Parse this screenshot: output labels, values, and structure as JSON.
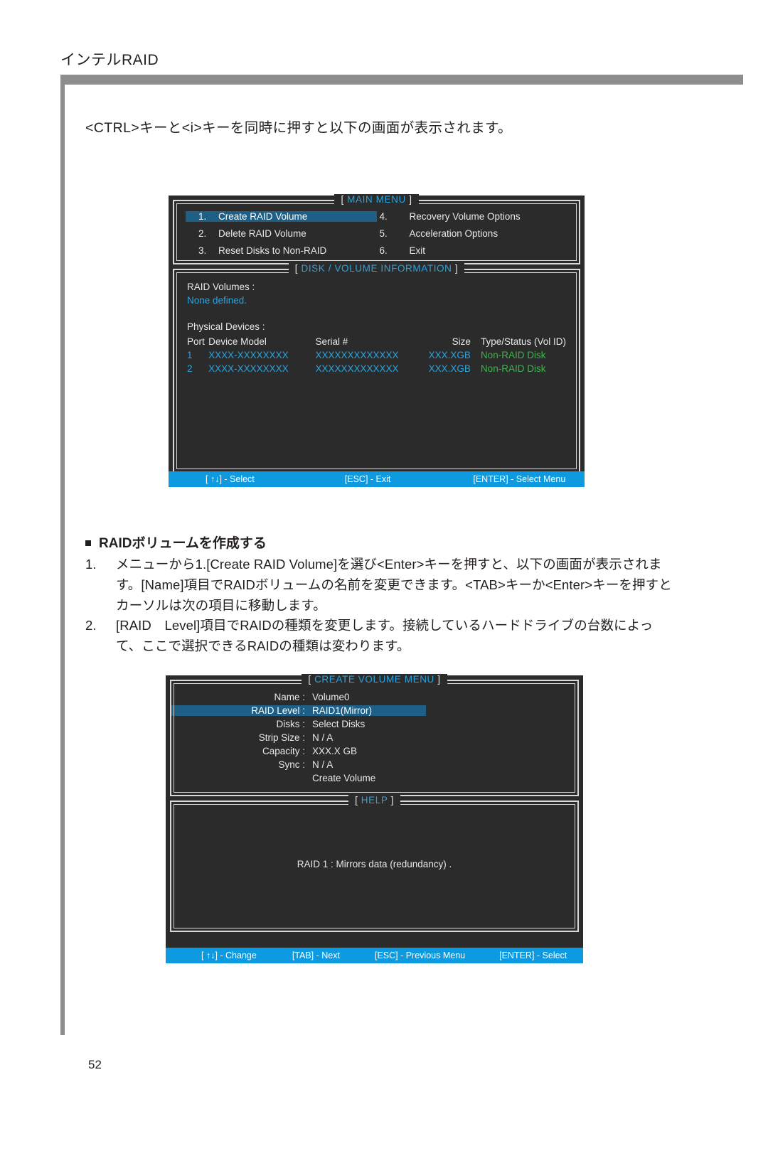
{
  "page": {
    "header_title": "インテルRAID",
    "page_number": "52",
    "intro_text": "<CTRL>キーと<i>キーを同時に押すと以下の画面が表示されます。",
    "section_heading": "RAIDボリュームを作成する",
    "steps": [
      {
        "number": "1.",
        "text": "メニューから1.[Create RAID Volume]を選び<Enter>キーを押すと、以下の画面が表示されます。[Name]項目でRAIDボリュームの名前を変更できます。<TAB>キーか<Enter>キーを押すとカーソルは次の項目に移動します。"
      },
      {
        "number": "2.",
        "text": "[RAID　Level]項目でRAIDの種類を変更します。接続しているハードドライブの台数によって、ここで選択できるRAIDの種類は変わります。"
      }
    ]
  },
  "colors": {
    "accent_blue": "#0e9ae0",
    "title_blue": "#2aa3e0",
    "highlight_blue": "#1d5f86",
    "status_green": "#3cb44a",
    "bios_bg": "#2b2b2b",
    "rule_gray": "#8b8d8f"
  },
  "main_menu_screen": {
    "title_open": "[",
    "title": "MAIN  MENU",
    "title_close": "]",
    "items_left": [
      {
        "index": "1.",
        "label": "Create  RAID  Volume",
        "selected": true
      },
      {
        "index": "2.",
        "label": "Delete  RAID  Volume",
        "selected": false
      },
      {
        "index": "3.",
        "label": "Reset Disks to Non-RAID",
        "selected": false
      }
    ],
    "items_right": [
      {
        "index": "4.",
        "label": "Recovery Volume  Options",
        "selected": false
      },
      {
        "index": "5.",
        "label": "Acceleration Options",
        "selected": false
      },
      {
        "index": "6.",
        "label": "Exit",
        "selected": false
      }
    ],
    "info_panel": {
      "title_open": "[",
      "title": "DISK / VOLUME INFORMATION",
      "title_close": "]",
      "raid_volumes_label": "RAID  Volumes :",
      "raid_volumes_value": "None  defined.",
      "physical_devices_label": "Physical Devices :",
      "columns": [
        "Port",
        "Device  Model",
        "Serial  #",
        "Size",
        "Type/Status (Vol  ID)"
      ],
      "rows": [
        {
          "port": "1",
          "model": "XXXX-XXXXXXXX",
          "serial": "XXXXXXXXXXXXX",
          "size": "XXX.XGB",
          "status": "Non-RAID  Disk"
        },
        {
          "port": "2",
          "model": "XXXX-XXXXXXXX",
          "serial": "XXXXXXXXXXXXX",
          "size": "XXX.XGB",
          "status": "Non-RAID  Disk"
        }
      ]
    },
    "action_bar": [
      "[ ↑↓] - Select",
      "[ESC] - Exit",
      "[ENTER] - Select Menu"
    ]
  },
  "create_volume_screen": {
    "title_open": "[",
    "title": "CREATE VOLUME MENU",
    "title_close": "]",
    "fields": [
      {
        "label": "Name :",
        "value": "Volume0",
        "selected": false
      },
      {
        "label": "RAID Level :",
        "value": "RAID1(Mirror)",
        "selected": true
      },
      {
        "label": "Disks :",
        "value": "Select  Disks",
        "selected": false
      },
      {
        "label": "Strip Size :",
        "value": "N / A",
        "selected": false
      },
      {
        "label": "Capacity :",
        "value": "XXX.X  GB",
        "selected": false
      },
      {
        "label": "Sync :",
        "value": "N / A",
        "selected": false
      },
      {
        "label": "",
        "value": "Create Volume",
        "selected": false
      }
    ],
    "help_panel": {
      "title_open": "[",
      "title": "HELP",
      "title_close": "]",
      "text": "RAID  1 : Mirrors  data  (redundancy) ."
    },
    "action_bar": [
      "[ ↑↓] - Change",
      "[TAB] - Next",
      "[ESC] - Previous Menu",
      "[ENTER] - Select"
    ]
  }
}
